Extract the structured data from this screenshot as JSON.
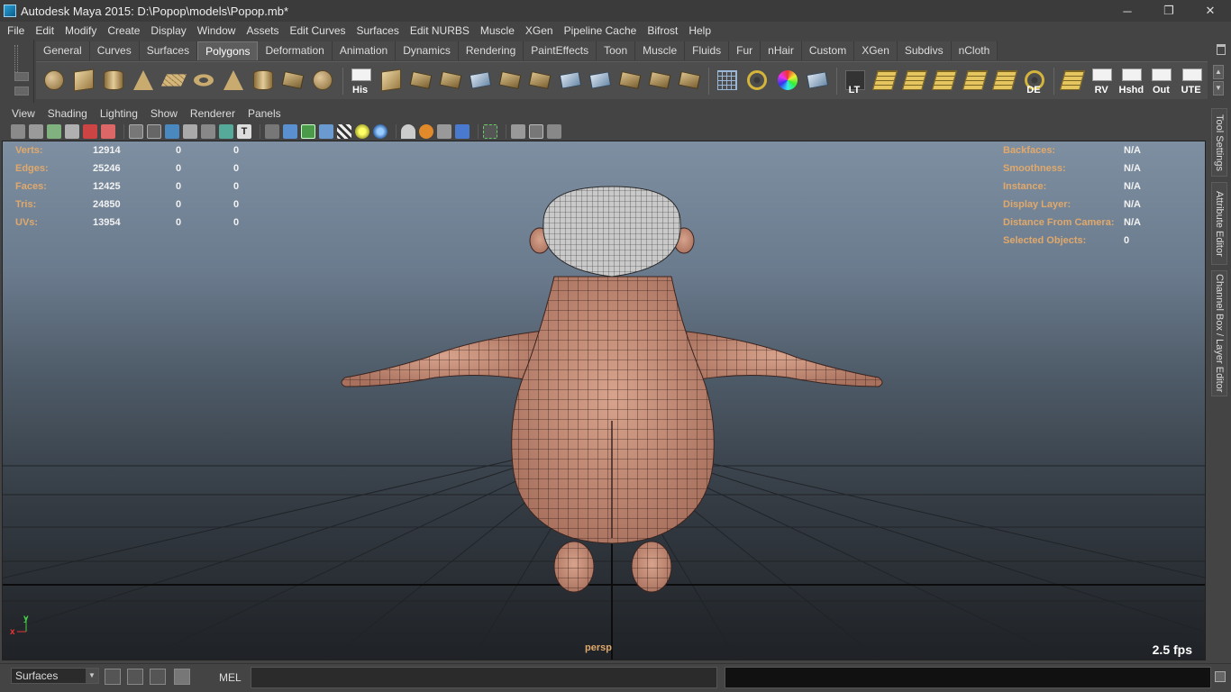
{
  "window": {
    "title": "Autodesk Maya 2015: D:\\Popop\\models\\Popop.mb*",
    "minimize": "─",
    "maximize": "❐",
    "close": "✕"
  },
  "menubar": [
    "File",
    "Edit",
    "Modify",
    "Create",
    "Display",
    "Window",
    "Assets",
    "Edit Curves",
    "Surfaces",
    "Edit NURBS",
    "Muscle",
    "XGen",
    "Pipeline Cache",
    "Bifrost",
    "Help"
  ],
  "shelf": {
    "tabs": [
      "General",
      "Curves",
      "Surfaces",
      "Polygons",
      "Deformation",
      "Animation",
      "Dynamics",
      "Rendering",
      "PaintEffects",
      "Toon",
      "Muscle",
      "Fluids",
      "Fur",
      "nHair",
      "Custom",
      "XGen",
      "Subdivs",
      "nCloth"
    ],
    "active_tab": "Polygons",
    "icons": [
      {
        "name": "poly-sphere-icon",
        "glyph": "sphere",
        "label": ""
      },
      {
        "name": "poly-cube-icon",
        "glyph": "cube",
        "label": ""
      },
      {
        "name": "poly-cylinder-icon",
        "glyph": "cyl",
        "label": ""
      },
      {
        "name": "poly-cone-icon",
        "glyph": "cone",
        "label": ""
      },
      {
        "name": "poly-plane-icon",
        "glyph": "plane",
        "label": ""
      },
      {
        "name": "poly-torus-icon",
        "glyph": "torus",
        "label": ""
      },
      {
        "name": "poly-pyramid-icon",
        "glyph": "cone",
        "label": ""
      },
      {
        "name": "poly-pipe-icon",
        "glyph": "cyl",
        "label": ""
      },
      {
        "name": "poly-helix-icon",
        "glyph": "tool",
        "label": ""
      },
      {
        "name": "poly-soccerball-icon",
        "glyph": "sphere",
        "label": ""
      },
      {
        "name": "history-icon",
        "glyph": "white",
        "label": "His"
      },
      {
        "name": "combine-icon",
        "glyph": "cube",
        "label": ""
      },
      {
        "name": "separate-icon",
        "glyph": "tool",
        "label": ""
      },
      {
        "name": "extract-icon",
        "glyph": "tool",
        "label": ""
      },
      {
        "name": "smooth-icon",
        "glyph": "blue",
        "label": ""
      },
      {
        "name": "bridge-icon",
        "glyph": "tool",
        "label": ""
      },
      {
        "name": "append-polygon-icon",
        "glyph": "tool",
        "label": ""
      },
      {
        "name": "split-polygon-icon",
        "glyph": "blue",
        "label": ""
      },
      {
        "name": "extrude-face-icon",
        "glyph": "blue",
        "label": ""
      },
      {
        "name": "cut-faces-icon",
        "glyph": "tool",
        "label": ""
      },
      {
        "name": "sculpt-geometry-icon",
        "glyph": "tool",
        "label": ""
      },
      {
        "name": "paint-tool-icon",
        "glyph": "tool",
        "label": ""
      },
      {
        "name": "wireframe-cube-icon",
        "glyph": "wire",
        "label": ""
      },
      {
        "name": "snap-magnet-icon",
        "glyph": "ring",
        "label": ""
      },
      {
        "name": "color-wheel-icon",
        "glyph": "color",
        "label": ""
      },
      {
        "name": "uv-editor-icon",
        "glyph": "blue",
        "label": ""
      },
      {
        "name": "lattice-icon",
        "glyph": "dark",
        "label": "LT"
      },
      {
        "name": "uv-layout-icon",
        "glyph": "yellowgrid",
        "label": ""
      },
      {
        "name": "uv-cut-icon",
        "glyph": "yellowgrid",
        "label": ""
      },
      {
        "name": "uv-sew-icon",
        "glyph": "yellowgrid",
        "label": ""
      },
      {
        "name": "uv-select-icon",
        "glyph": "yellowgrid",
        "label": ""
      },
      {
        "name": "uv-move-icon",
        "glyph": "yellowgrid",
        "label": ""
      },
      {
        "name": "light-icon",
        "glyph": "ring",
        "label": "DE"
      },
      {
        "name": "uv-snapshot-icon",
        "glyph": "yellowgrid",
        "label": ""
      },
      {
        "name": "render-view-icon",
        "glyph": "white",
        "label": "RV"
      },
      {
        "name": "hypershade-icon",
        "glyph": "white",
        "label": "Hshd"
      },
      {
        "name": "outliner-icon",
        "glyph": "white",
        "label": "Out"
      },
      {
        "name": "uv-texture-editor-icon",
        "glyph": "white",
        "label": "UTE"
      }
    ]
  },
  "panel_menu": [
    "View",
    "Shading",
    "Lighting",
    "Show",
    "Renderer",
    "Panels"
  ],
  "hud_left": [
    {
      "label": "Verts:",
      "v1": "12914",
      "v2": "0",
      "v3": "0"
    },
    {
      "label": "Edges:",
      "v1": "25246",
      "v2": "0",
      "v3": "0"
    },
    {
      "label": "Faces:",
      "v1": "12425",
      "v2": "0",
      "v3": "0"
    },
    {
      "label": "Tris:",
      "v1": "24850",
      "v2": "0",
      "v3": "0"
    },
    {
      "label": "UVs:",
      "v1": "13954",
      "v2": "0",
      "v3": "0"
    }
  ],
  "hud_right": [
    {
      "label": "Backfaces:",
      "value": "N/A"
    },
    {
      "label": "Smoothness:",
      "value": "N/A"
    },
    {
      "label": "Instance:",
      "value": "N/A"
    },
    {
      "label": "Display Layer:",
      "value": "N/A"
    },
    {
      "label": "Distance From Camera:",
      "value": "N/A"
    },
    {
      "label": "Selected Objects:",
      "value": "0"
    }
  ],
  "viewport": {
    "camera": "persp",
    "fps": "2.5 fps",
    "axis_x": "x",
    "axis_y": "y"
  },
  "side_tabs": [
    "Tool Settings",
    "Attribute Editor",
    "Channel Box / Layer Editor"
  ],
  "command_line": {
    "mode": "Surfaces",
    "language": "MEL"
  },
  "colors": {
    "hud_label": "#e0a96b",
    "model_skin": "#c8907a",
    "accent": "#5d5d5d"
  }
}
